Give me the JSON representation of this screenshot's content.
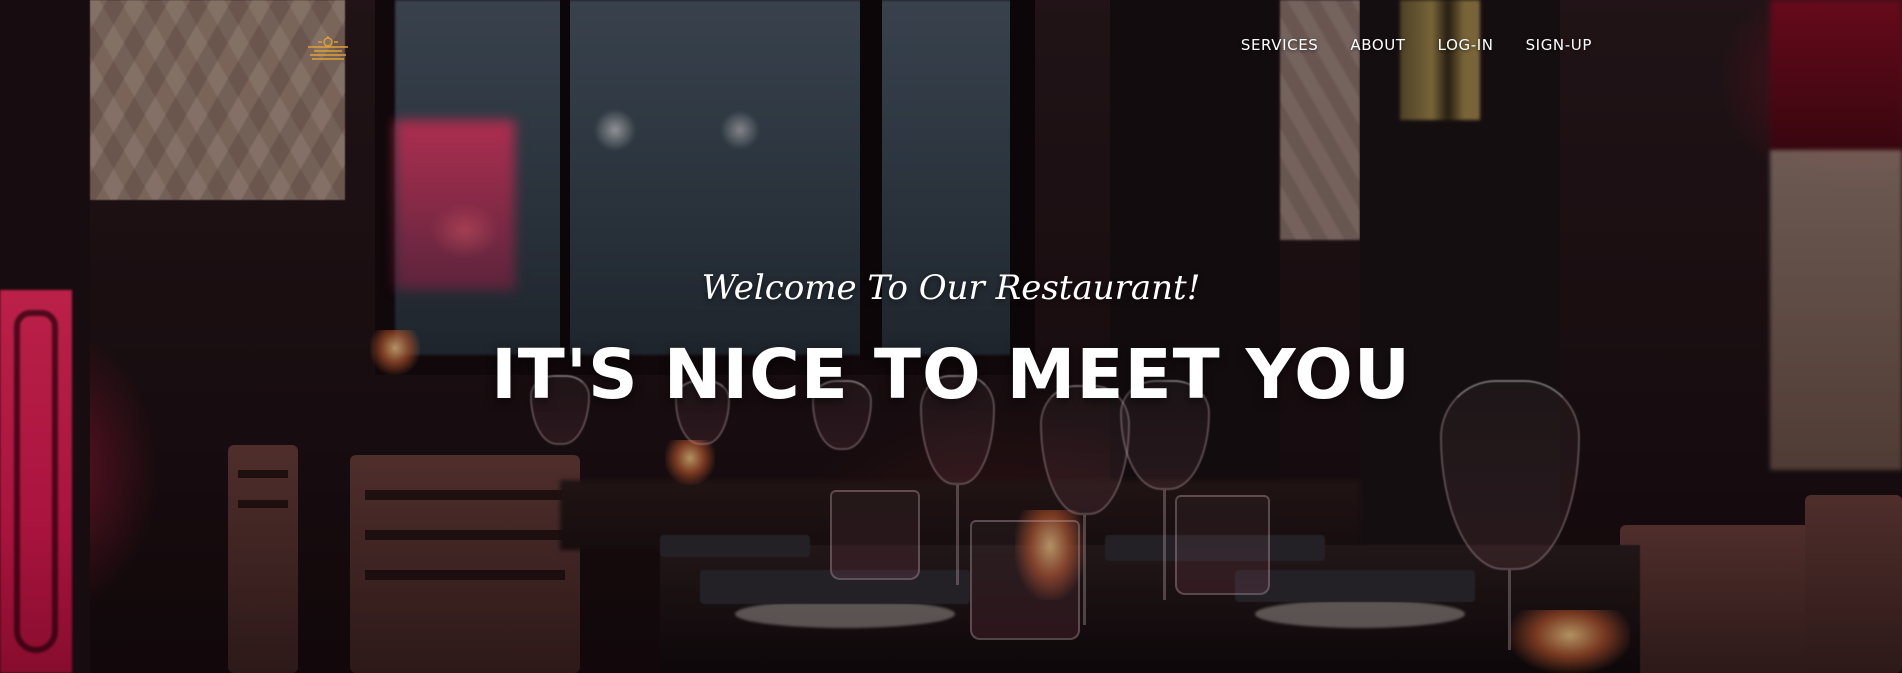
{
  "brand": {
    "logo_icon": "restaurant-logo-icon",
    "accent_color": "#e0a134"
  },
  "nav": {
    "items": [
      {
        "label": "SERVICES"
      },
      {
        "label": "ABOUT"
      },
      {
        "label": "LOG-IN"
      },
      {
        "label": "SIGN-UP"
      }
    ]
  },
  "hero": {
    "subheading": "Welcome To Our Restaurant!",
    "heading": "IT'S NICE TO MEET YOU",
    "background": "restaurant-dining-photo"
  }
}
